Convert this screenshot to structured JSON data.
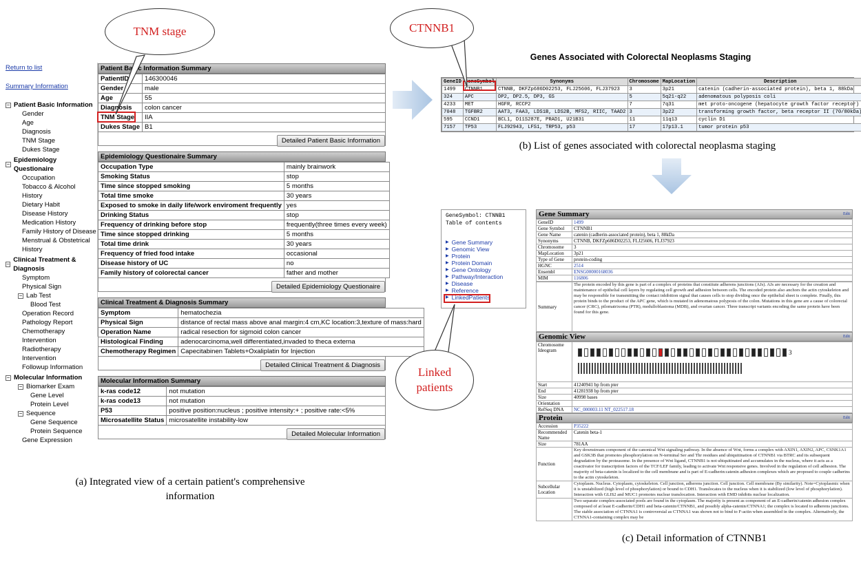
{
  "callouts": {
    "tnm": "TNM stage",
    "ctnnb1": "CTNNB1",
    "linked": "Linked patients"
  },
  "captions": {
    "a": "(a) Integrated view of a certain patient's comprehensive information",
    "b": "(b) List of genes associated with colorectal  neoplasma staging",
    "c": "(c) Detail information of CTNNB1"
  },
  "panel_a": {
    "sidebar": {
      "return_link": "Return to list",
      "summary_link": "Summary Information",
      "groups": [
        {
          "label": "Patient Basic Information",
          "items": [
            "Gender",
            "Age",
            "Diagnosis",
            "TNM Stage",
            "Dukes Stage"
          ]
        },
        {
          "label": "Epidemiology Questionaire",
          "items": [
            "Occupation",
            "Tobacco & Alcohol History",
            "Dietary Habit",
            "Disease History",
            "Medication History",
            "Family History of Disease",
            "Menstrual & Obstetrical History"
          ]
        },
        {
          "label": "Clinical Treatment & Diagnosis",
          "items": [
            "Symptom",
            "Physical Sign"
          ],
          "sub": "Lab Test",
          "sub_items": [
            "Blood Test"
          ],
          "items_after": [
            "Operation Record",
            "Pathology Report",
            "Chemotherapy Intervention",
            "Radiotherapy Intervention",
            "Followup Information"
          ]
        },
        {
          "label": "Molecular Information",
          "sub": "Biomarker Exam",
          "sub_items": [
            "Gene Level",
            "Protein Level"
          ],
          "sub2": "Sequence",
          "sub2_items": [
            "Gene Sequence",
            "Protein Sequence"
          ],
          "items_after": [
            "Gene Expression"
          ]
        }
      ]
    },
    "basic": {
      "title": "Patient Basic Information Summary",
      "rows": [
        [
          "PatientID",
          "146300046"
        ],
        [
          "Gender",
          "male"
        ],
        [
          "Age",
          "55"
        ],
        [
          "Diagnosis",
          "colon cancer"
        ],
        [
          "TNM Stage",
          "IIA"
        ],
        [
          "Dukes Stage",
          "B1"
        ]
      ],
      "button": "Detailed Patient Basic Information"
    },
    "epi": {
      "title": "Epidemiology Questionaire Summary",
      "rows": [
        [
          "Occupation Type",
          "mainly brainwork"
        ],
        [
          "Smoking Status",
          "stop"
        ],
        [
          "Time since stopped smoking",
          "5 months"
        ],
        [
          "Total time  smoke",
          "30 years"
        ],
        [
          "Exposed to smoke in daily life/work enviroment frequently",
          "yes"
        ],
        [
          "Drinking Status",
          "stop"
        ],
        [
          "Frequency of drinking before stop",
          "frequently(three times every week)"
        ],
        [
          "Time since stopped drinking",
          "5 months"
        ],
        [
          "Total time drink",
          "30 years"
        ],
        [
          "Frequency of fried food intake",
          "occasional"
        ],
        [
          "Disease history of UC",
          "no"
        ],
        [
          "Family history of colorectal cancer",
          "father and mother"
        ]
      ],
      "button": "Detailed Epidemiology Questionaire"
    },
    "clin": {
      "title": "Clinical Treatment & Diagnosis Summary",
      "rows": [
        [
          "Symptom",
          "hematochezia"
        ],
        [
          "Physical Sign",
          "distance of rectal mass above anal margin:4 cm,KC location:3,texture of mass:hard"
        ],
        [
          "Operation  Name",
          "radical resection for sigmoid colon cancer"
        ],
        [
          "Histological Finding",
          "adenocarcinoma,well differentiated,invaded to theca externa"
        ],
        [
          "Chemotherapy Regimen",
          "Capecitabinen Tablets+Oxaliplatin for Injection"
        ]
      ],
      "button": "Detailed Clinical Treatment & Diagnosis"
    },
    "mol": {
      "title": "Molecular Information Summary",
      "rows": [
        [
          "k-ras code12",
          "not  mutation"
        ],
        [
          "k-ras code13",
          "not  mutation"
        ],
        [
          "P53",
          "positive position:nucleus ; positive  intensity:+ ; positive  rate:<5%"
        ],
        [
          "Microsatellite Status",
          "microsatellite instability-low"
        ]
      ],
      "button": "Detailed Molecular Information"
    }
  },
  "panel_b": {
    "title": "Genes Associated with Colorectal Neoplasms Staging",
    "headers": [
      "GeneID",
      "GeneSymbol",
      "Synonyms",
      "Chromosome",
      "MapLocation",
      "Description"
    ],
    "rows": [
      [
        "1499",
        "CTNNB1",
        "CTNNB, DKFZp686D02253, FLJ25606, FLJ37923",
        "3",
        "3p21",
        "catenin (cadherin-associated protein), beta 1, 88kDa"
      ],
      [
        "324",
        "APC",
        "DP2, DP2.5, DP3, GS",
        "5",
        "5q21-q22",
        "adenomatous polyposis coli"
      ],
      [
        "4233",
        "MET",
        "HGFR, RCCP2",
        "7",
        "7q31",
        "met proto-oncogene (hepatocyte growth factor receptor)"
      ],
      [
        "7048",
        "TGFBR2",
        "AAT3, FAA3, LDS1B, LDS2B, MFS2, RIIC, TAAD2",
        "3",
        "3p22",
        "transforming growth factor, beta receptor II (70/80kDa)"
      ],
      [
        "595",
        "CCND1",
        "BCL1, D11S287E, PRAD1, U21B31",
        "11",
        "11q13",
        "cyclin D1"
      ],
      [
        "7157",
        "TP53",
        "FLJ92943, LFS1, TRP53, p53",
        "17",
        "17p13.1",
        "tumor protein p53"
      ]
    ]
  },
  "panel_c": {
    "toc_title": "GeneSymbol: CTNNB1",
    "toc_sub": "Table of contents",
    "toc_items": [
      "Gene Summary",
      "Genomic View",
      "Protein",
      "Protein Domain",
      "Gene Ontology",
      "Pathway/Interaction",
      "Disease",
      "Reference",
      "LinkedPatients"
    ],
    "gene_summary_title": "Gene Summary",
    "edit_label": "Edit",
    "gene_summary": [
      [
        "GeneID",
        "1499"
      ],
      [
        "Gene Symbol",
        "CTNNB1"
      ],
      [
        "Gene Name",
        "catenin (cadherin-associated protein), beta 1, 88kDa"
      ],
      [
        "Synonyms",
        "CTNNB, DKFZp686D02253, FLJ25606, FLJ37923"
      ],
      [
        "Chromosome",
        "3"
      ],
      [
        "MapLocation",
        "3p21"
      ],
      [
        "Type of Gene",
        "protein-coding"
      ],
      [
        "HGNC",
        "2514"
      ],
      [
        "Ensembl",
        "ENSG00000168036"
      ],
      [
        "MIM",
        "116806"
      ]
    ],
    "summary_label": "Summary",
    "summary_text": "The protein encoded by this gene is part of a complex of proteins that constitute adherens junctions (AJs). AJs are necessary for the creation and maintenance of epithelial cell layers by regulating cell growth and adhesion between cells. The encoded protein also anchors the actin cytoskeleton and may be responsible for transmitting the contact inhibition signal that causes cells to stop dividing once the epithelial sheet is complete. Finally, this protein binds to the product of the APC gene, which is mutated in adenomatous polyposis of the colon. Mutations in this gene are a cause of colorectal cancer (CRC), pilomatrixoma (PTR), medulloblastoma (MDB), and ovarian cancer. Three transcript variants encoding the same protein have been found for this gene.",
    "genomic_title": "Genomic View",
    "genomic_rows": [
      [
        "Chromosome Ideogram",
        ""
      ],
      [
        "Start",
        "41240941 bp from pter"
      ],
      [
        "End",
        "41281938 bp from pter"
      ],
      [
        "Size",
        "40998 bases"
      ],
      [
        "Orientation",
        ""
      ],
      [
        "RefSeq DNA",
        "NC_000003.11     NT_022517.18"
      ]
    ],
    "chromosome_label": "3",
    "protein_title": "Protein",
    "protein_rows": [
      [
        "Accession",
        "P35222"
      ],
      [
        "Recommended Name",
        "Catenin beta-1"
      ],
      [
        "Size",
        "781AA"
      ],
      [
        "Function",
        "Key downstream component of the canonical Wnt signaling pathway. In the absence of Wnt, forms a complex with AXIN1, AXIN2, APC, CSNK1A1 and GSK3B that promotes phosphorylation on N-terminal Ser and Thr residues and ubiquitination of CTNNB1 via BTRC and its subsequent degradation by the proteasome. In the presence of Wnt ligand, CTNNB1 is not ubiquitinated and accumulates in the nucleus, where it acts as a coactivator for transcription factors of the TCF/LEF family, leading to activate Wnt responsive genes. Involved in the regulation of cell adhesion. The majority of beta-catenin is localized to the cell membrane and is part of E-cadherin:catenin adhesion complexes which are proposed to couple cadherins to the actin cytoskeleton."
      ],
      [
        "Subcellular Location",
        "Cytoplasm. Nucleus. Cytoplasm, cytoskeleton. Cell junction, adherens junction. Cell junction. Cell membrane (By similarity). Note=Cytoplasmic when it is unstabilized (high level of phosphorylation) or bound to CDH1. Translocates to the nucleus when it is stabilized (low level of phosphorylation). Interaction with GLIS2 and MUC1 promotes nuclear translocation. Interaction with EMD inhibits nuclear localization."
      ],
      [
        "",
        "Two separate complex-associated pools are found in the cytoplasm. The majority is present as component of an E-cadherin/catenin adhesion complex composed of at least E-cadherin/CDH1 and beta-catenin/CTNNB1, and possibly alpha-catenin/CTNNA1; the complex is located to adherens junctions. The stable association of CTNNA1 is controversial as CTNNA1 was shown not to bind to F-actin when assembled in the complex. Alternatively, the CTNNA1-containing complex may be"
      ]
    ]
  }
}
